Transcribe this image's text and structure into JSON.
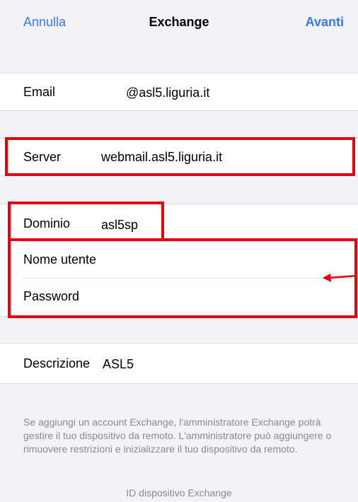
{
  "nav": {
    "cancel_label": "Annulla",
    "title": "Exchange",
    "next_label": "Avanti"
  },
  "form": {
    "email": {
      "label": "Email",
      "value": "@asl5.liguria.it"
    },
    "server": {
      "label": "Server",
      "value": "webmail.asl5.liguria.it"
    },
    "domain": {
      "label": "Dominio",
      "value": "asl5sp"
    },
    "username": {
      "label": "Nome utente",
      "value": ""
    },
    "password": {
      "label": "Password",
      "value": ""
    },
    "description": {
      "label": "Descrizione",
      "value": "ASL5"
    }
  },
  "footer": {
    "info": "Se aggiungi un account Exchange, l'amministratore Exchange potrà gestire il tuo dispositivo da remoto. L'amministratore può aggiungere o rimuovere restrizioni e inizializzare il tuo dispositivo da remoto.",
    "device_id_label": "ID dispositivo Exchange"
  },
  "colors": {
    "accent": "#3478f6",
    "highlight": "#e8000b",
    "background": "#f2f2f7"
  }
}
